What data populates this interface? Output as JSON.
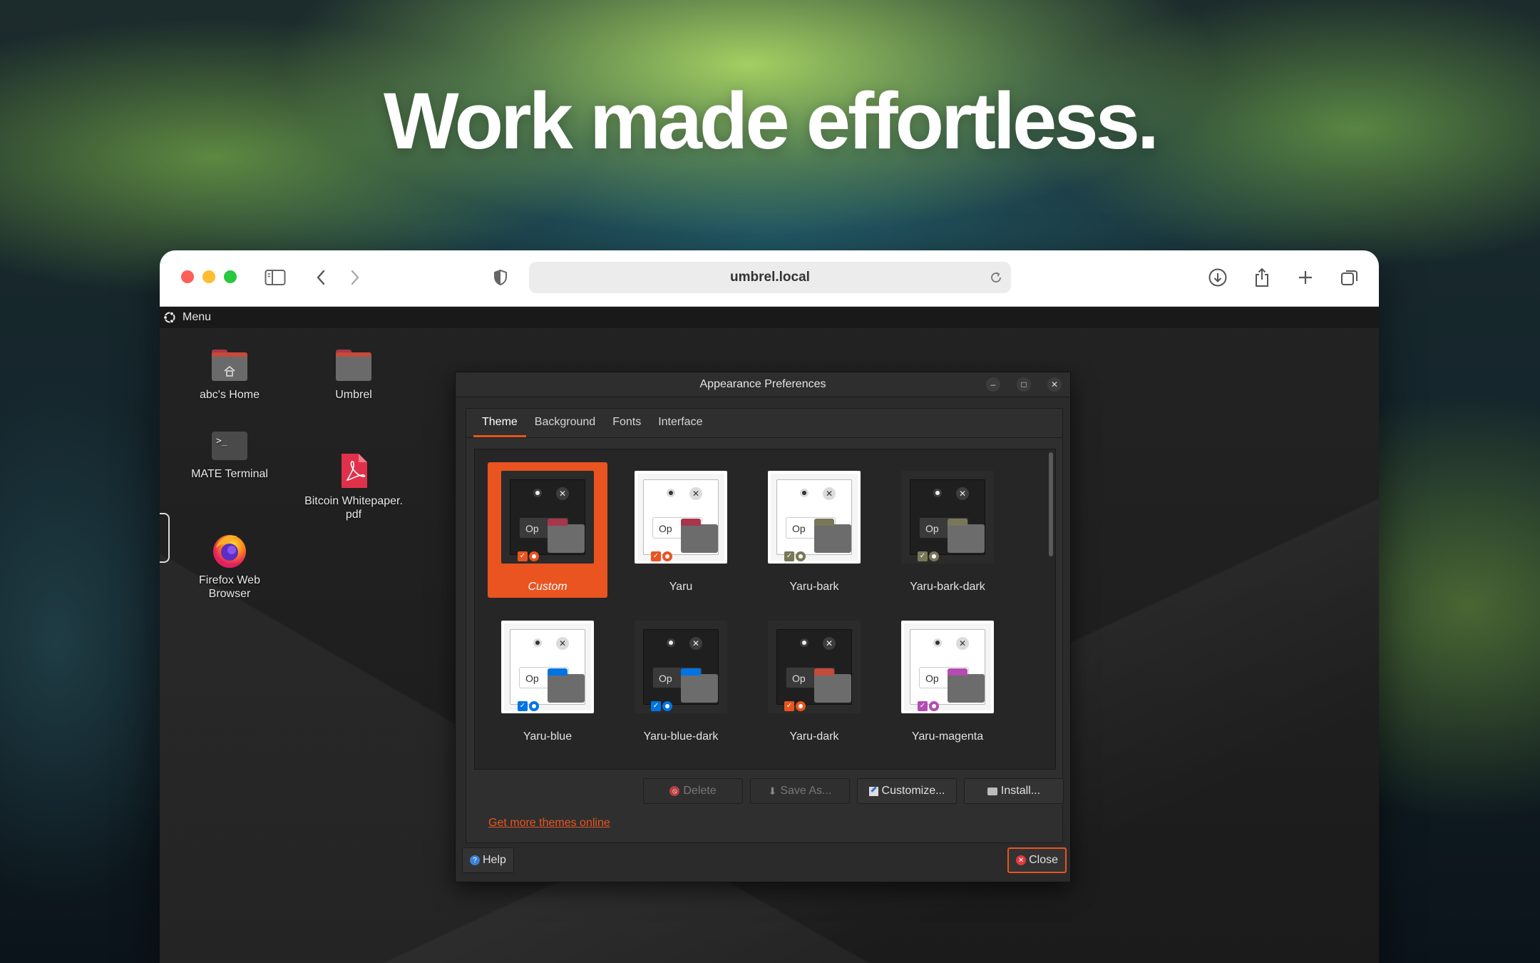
{
  "hero": {
    "headline": "Work made effortless."
  },
  "browser": {
    "address": "umbrel.local"
  },
  "desktop": {
    "menu_label": "Menu",
    "icons": [
      {
        "label": "abc's Home",
        "icon": "home-folder-icon"
      },
      {
        "label": "Umbrel",
        "icon": "folder-icon"
      },
      {
        "label": "MATE Terminal",
        "icon": "terminal-icon"
      },
      {
        "label": "Bitcoin Whitepaper.\npdf",
        "icon": "pdf-icon"
      },
      {
        "label": "Firefox Web\nBrowser",
        "icon": "firefox-icon"
      }
    ]
  },
  "dialog": {
    "title": "Appearance Preferences",
    "tabs": [
      "Theme",
      "Background",
      "Fonts",
      "Interface"
    ],
    "active_tab": "Theme",
    "themes": [
      {
        "name": "Custom",
        "variant": "dark",
        "accent": "#e95420",
        "folder": "#a8364a",
        "selected": true
      },
      {
        "name": "Yaru",
        "variant": "light",
        "accent": "#e95420",
        "folder": "#a8364a",
        "selected": false
      },
      {
        "name": "Yaru-bark",
        "variant": "light",
        "accent": "#787859",
        "folder": "#787859",
        "selected": false
      },
      {
        "name": "Yaru-bark-dark",
        "variant": "dark",
        "accent": "#787859",
        "folder": "#787859",
        "selected": false
      },
      {
        "name": "Yaru-blue",
        "variant": "light",
        "accent": "#0073e5",
        "folder": "#0073e5",
        "selected": false
      },
      {
        "name": "Yaru-blue-dark",
        "variant": "dark",
        "accent": "#0073e5",
        "folder": "#0073e5",
        "selected": false
      },
      {
        "name": "Yaru-dark",
        "variant": "dark",
        "accent": "#e95420",
        "folder": "#c54a3b",
        "selected": false
      },
      {
        "name": "Yaru-magenta",
        "variant": "light",
        "accent": "#b34cb3",
        "folder": "#b34cb3",
        "selected": false
      }
    ],
    "preview_button_text": "Op",
    "buttons": {
      "delete": "Delete",
      "save_as": "Save As...",
      "customize": "Customize...",
      "install": "Install..."
    },
    "more_themes_link": "Get more themes online",
    "help": "Help",
    "close": "Close"
  }
}
